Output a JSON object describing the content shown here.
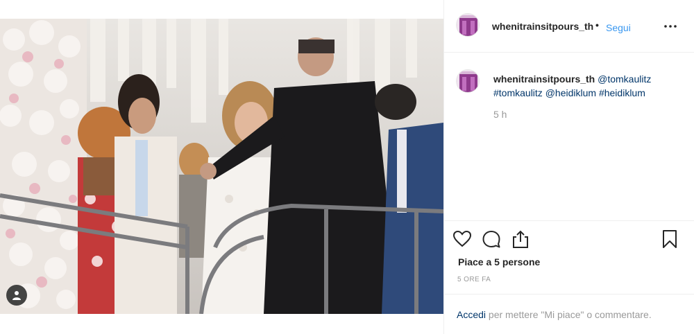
{
  "post": {
    "username": "whenitrainsitpours_th",
    "follow_label": "Segui",
    "separator": "•",
    "more_icon": "more-horizontal-icon"
  },
  "caption": {
    "username": "whenitrainsitpours_th",
    "mentions": [
      "@tomkaulitz",
      "#tomkaulitz",
      "@heidiklum",
      "#heidiklum"
    ],
    "relative_time": "5 h"
  },
  "actions": {
    "like_icon": "heart-icon",
    "comment_icon": "comment-icon",
    "share_icon": "share-icon",
    "save_icon": "bookmark-icon"
  },
  "likes_text": "Piace a 5 persone",
  "posted_ago": "5 ORE FA",
  "login": {
    "link_label": "Accedi",
    "rest_text": " per mettere \"Mi piace\" o commentare."
  },
  "colors": {
    "link_blue": "#3897f0",
    "mention_blue": "#003569",
    "secondary_text": "#999999",
    "avatar_purple": "#8e3a8c"
  }
}
